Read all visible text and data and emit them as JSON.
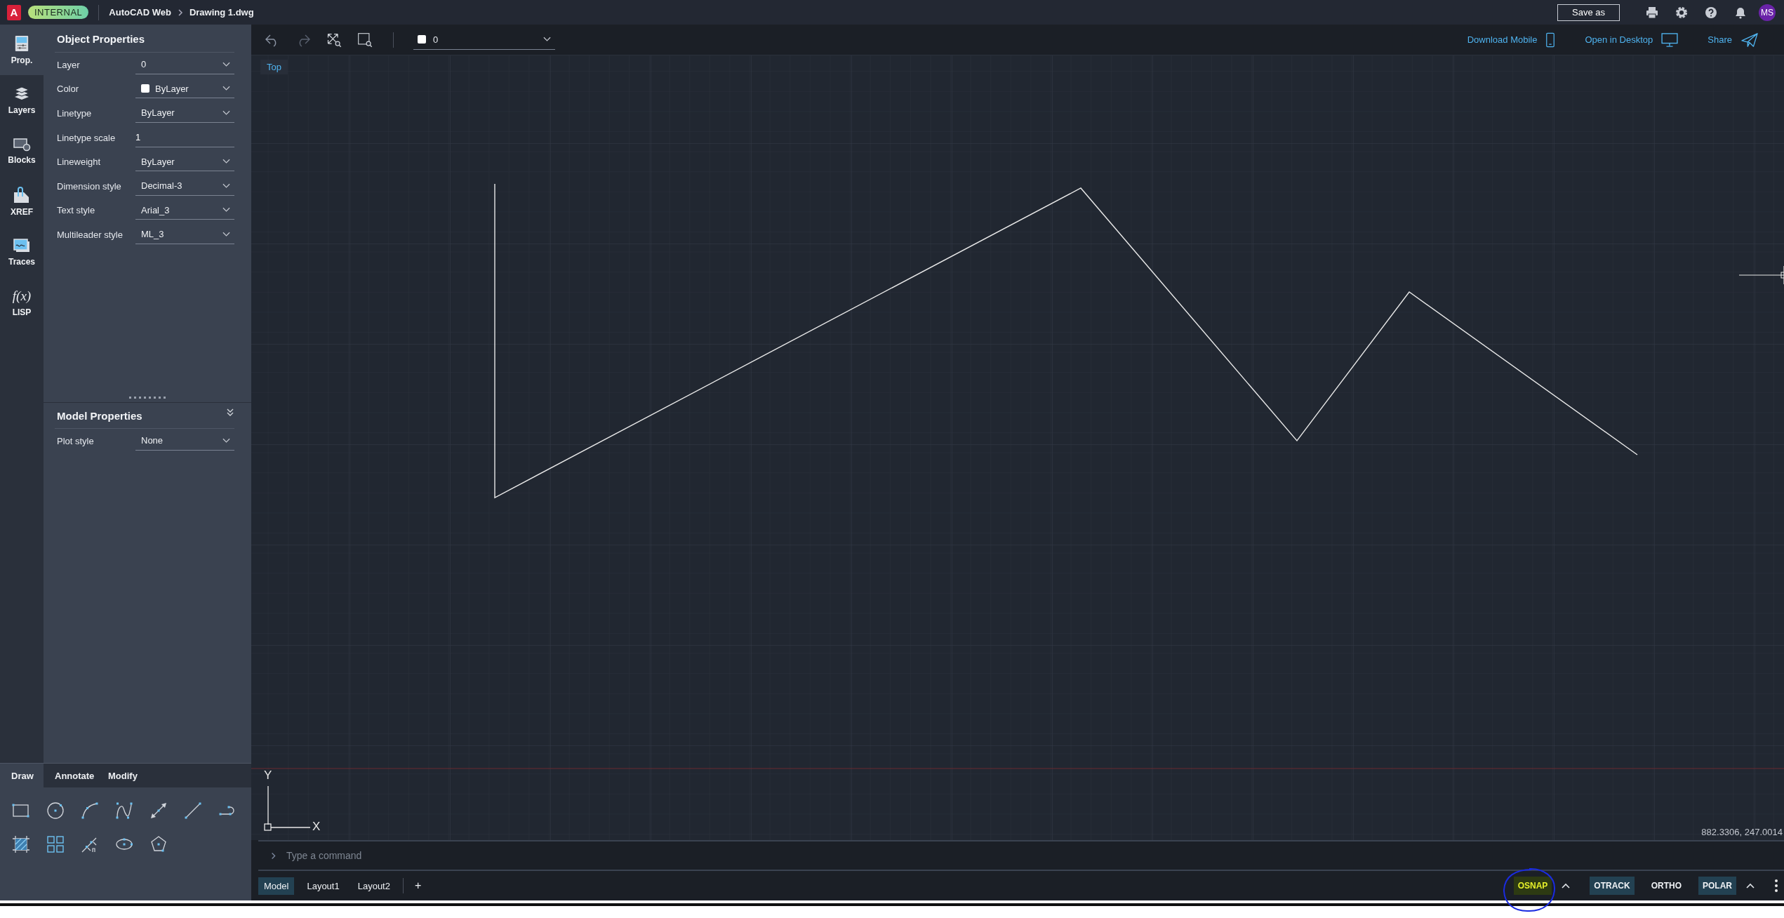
{
  "header": {
    "logo": "A",
    "badge": "INTERNAL",
    "app": "AutoCAD Web",
    "file": "Drawing 1.dwg",
    "save": "Save as",
    "avatar": "MS"
  },
  "rail": [
    {
      "kind": "properties",
      "label": "Prop.",
      "selected": true
    },
    {
      "kind": "layers",
      "label": "Layers",
      "selected": false
    },
    {
      "kind": "blocks",
      "label": "Blocks",
      "selected": false
    },
    {
      "kind": "xref",
      "label": "XREF",
      "selected": false
    },
    {
      "kind": "traces",
      "label": "Traces",
      "selected": false
    },
    {
      "kind": "lisp",
      "label": "LISP",
      "glyph": "f(x)",
      "selected": false
    }
  ],
  "object_properties": {
    "title": "Object Properties",
    "rows": [
      {
        "kind": "dropdown",
        "label": "Layer",
        "value": "0"
      },
      {
        "kind": "color",
        "label": "Color",
        "value": "ByLayer"
      },
      {
        "kind": "dropdown",
        "label": "Linetype",
        "value": "ByLayer"
      },
      {
        "kind": "input",
        "label": "Linetype scale",
        "value": "1"
      },
      {
        "kind": "dropdown",
        "label": "Lineweight",
        "value": "ByLayer"
      },
      {
        "kind": "dropdown",
        "label": "Dimension style",
        "value": "Decimal-3"
      },
      {
        "kind": "dropdown",
        "label": "Text style",
        "value": "Arial_3"
      },
      {
        "kind": "dropdown",
        "label": "Multileader style",
        "value": "ML_3"
      }
    ]
  },
  "model_properties": {
    "title": "Model Properties",
    "rows": [
      {
        "kind": "dropdown",
        "label": "Plot style",
        "value": "None"
      }
    ]
  },
  "tool_tabs": [
    {
      "label": "Draw",
      "selected": true
    },
    {
      "label": "Annotate",
      "selected": false
    },
    {
      "label": "Modify",
      "selected": false
    }
  ],
  "toolbar": {
    "layer": "0",
    "links": [
      {
        "kind": "mobile",
        "label": "Download Mobile"
      },
      {
        "kind": "desktop",
        "label": "Open in Desktop"
      },
      {
        "kind": "share",
        "label": "Share"
      }
    ]
  },
  "viewport": {
    "view": "Top",
    "axis_y": "Y",
    "axis_x": "X",
    "coordinates": "882.3306, 247.0014"
  },
  "command": {
    "placeholder": "Type a command"
  },
  "layout_tabs": [
    {
      "label": "Model",
      "selected": true
    },
    {
      "label": "Layout1",
      "selected": false
    },
    {
      "label": "Layout2",
      "selected": false
    }
  ],
  "add_layout": "+",
  "status_toggles": [
    {
      "label": "OSNAP",
      "on": true,
      "kind": "snap",
      "menu": true
    },
    {
      "label": "OTRACK",
      "on": true,
      "kind": "normal",
      "menu": false
    },
    {
      "label": "ORTHO",
      "on": false,
      "kind": "normal",
      "menu": false
    },
    {
      "label": "POLAR",
      "on": true,
      "kind": "normal",
      "menu": true
    }
  ]
}
